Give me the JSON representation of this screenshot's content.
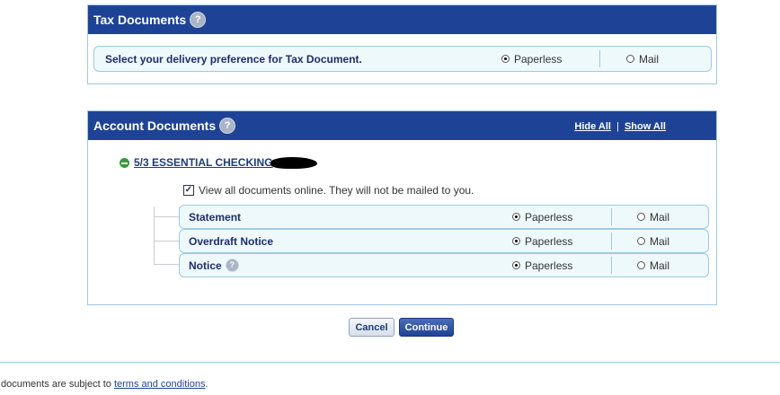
{
  "tax": {
    "title": "Tax Documents",
    "help_icon": "?",
    "row_label": "Select your delivery preference for Tax Document.",
    "paperless": "Paperless",
    "mail": "Mail",
    "selected": "paperless"
  },
  "account": {
    "title": "Account Documents",
    "help_icon": "?",
    "hide_all": "Hide All",
    "show_all": "Show All",
    "account_link": "5/3 ESSENTIAL CHECKING",
    "view_online_label": "View all documents online. They will not be mailed to you.",
    "view_online_checked": true,
    "documents": [
      {
        "label": "Statement",
        "paperless": "Paperless",
        "mail": "Mail",
        "selected": "paperless"
      },
      {
        "label": "Overdraft Notice",
        "paperless": "Paperless",
        "mail": "Mail",
        "selected": "paperless"
      },
      {
        "label": "Notice",
        "paperless": "Paperless",
        "mail": "Mail",
        "selected": "paperless"
      }
    ]
  },
  "buttons": {
    "cancel": "Cancel",
    "continue": "Continue"
  },
  "footer": {
    "prefix": "documents are subject to",
    "link": "terms and conditions",
    "suffix": "."
  },
  "colors": {
    "header_bg": "#1e4396",
    "row_bg": "#eef9fc",
    "border": "#9ec9e0"
  }
}
